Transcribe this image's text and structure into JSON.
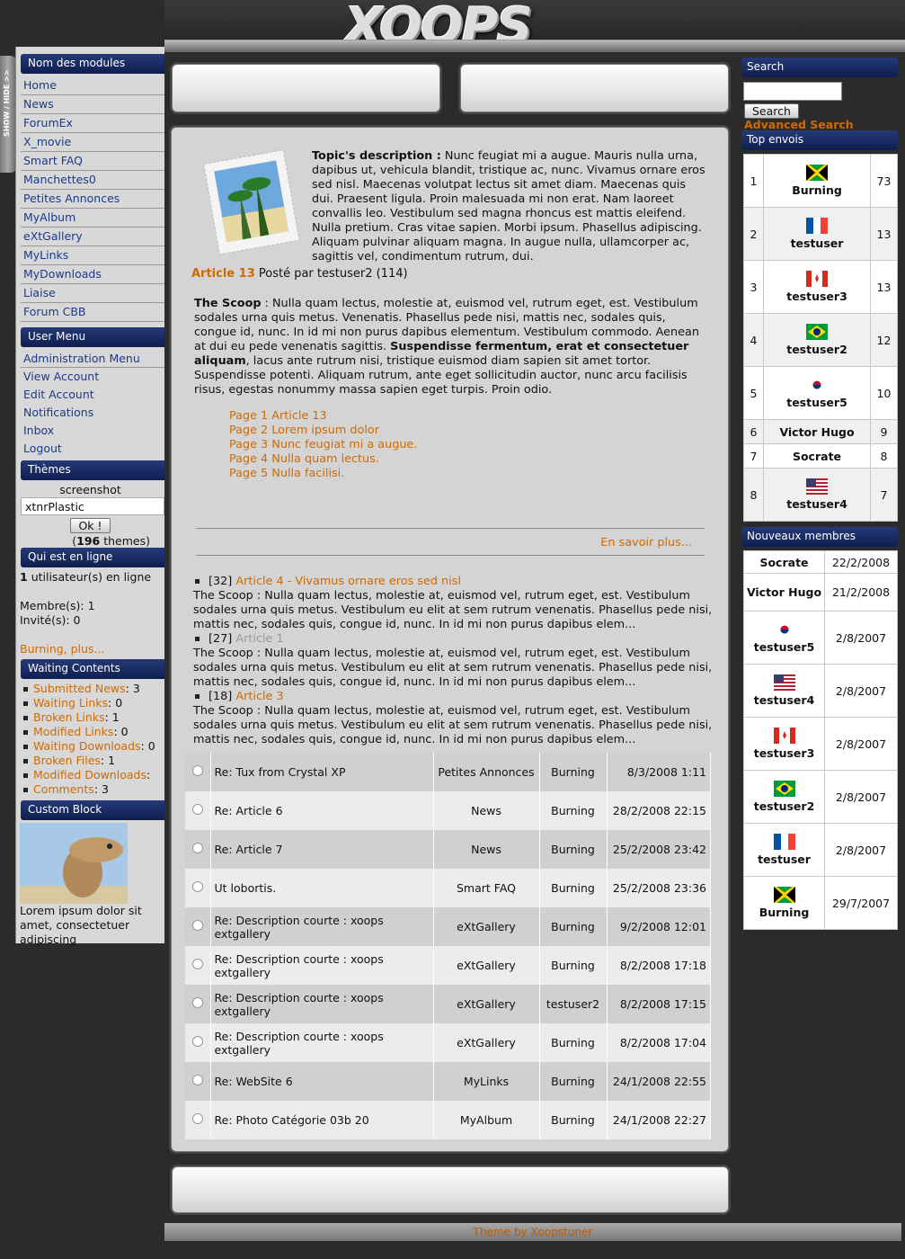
{
  "header": {
    "logo": "XOOPS"
  },
  "showhide": "SHOW / HIDE >>",
  "modules": {
    "title": "Nom des modules",
    "items": [
      "Home",
      "News",
      "ForumEx",
      "X_movie",
      "Smart FAQ",
      "Manchettes0",
      "Petites Annonces",
      "MyAlbum",
      "eXtGallery",
      "MyLinks",
      "MyDownloads",
      "Liaise",
      "Forum CBB"
    ]
  },
  "user_menu": {
    "title": "User Menu",
    "items": [
      "Administration Menu",
      "View Account",
      "Edit Account",
      "Notifications",
      "Inbox",
      "Logout"
    ]
  },
  "themes": {
    "title": "Thèmes",
    "screenshot": "screenshot",
    "selected": "xtnrPlastic",
    "ok": "Ok !",
    "count": "196",
    "count_suffix": "themes)",
    "count_prefix": "("
  },
  "online": {
    "title": "Qui est en ligne",
    "count": "1",
    "line1": "utilisateur(s) en ligne",
    "members": "Membre(s):  1",
    "guests": "Invité(s):  0",
    "user": "Burning",
    "more": "plus..."
  },
  "waiting": {
    "title": "Waiting Contents",
    "items": [
      {
        "label": "Submitted News",
        "count": "3"
      },
      {
        "label": "Waiting Links",
        "count": "0"
      },
      {
        "label": "Broken Links",
        "count": "1"
      },
      {
        "label": "Modified Links",
        "count": "0"
      },
      {
        "label": "Waiting Downloads",
        "count": "0"
      },
      {
        "label": "Broken Files",
        "count": "1"
      },
      {
        "label": "Modified Downloads",
        "count": ""
      },
      {
        "label": "Comments",
        "count": "3"
      }
    ]
  },
  "custom": {
    "title": "Custom Block",
    "text": "Lorem ipsum dolor sit amet, consectetuer adipiscing"
  },
  "article": {
    "topic_label": "Topic's description :",
    "topic_text": "Nunc feugiat mi a augue. Mauris nulla urna, dapibus ut, vehicula blandit, tristique ac, nunc. Vivamus ornare eros sed nisl. Maecenas volutpat lectus sit amet diam. Maecenas quis dui. Praesent ligula. Proin malesuada mi non erat. Nam laoreet convallis leo. Vestibulum sed magna rhoncus est mattis eleifend. Nulla pretium. Cras vitae sapien. Morbi ipsum. Phasellus adipiscing. Aliquam pulvinar aliquam magna. In augue nulla, ullamcorper ac, sagittis vel, condimentum rutrum, dui.",
    "link": "Article 13",
    "byline": " Posté par testuser2 (114)",
    "scoop_label": "The Scoop",
    "scoop_text1": " : Nulla quam lectus, molestie at, euismod vel, rutrum eget, est. Vestibulum sodales urna quis metus. Venenatis. Phasellus pede nisi, mattis nec, sodales quis, congue id, nunc. In id mi non purus dapibus elementum. Vestibulum commodo. Aenean at dui eu pede venenatis sagittis. ",
    "scoop_bold": "Suspendisse fermentum, erat et consectetuer aliquam",
    "scoop_text2": ", lacus ante rutrum nisi, tristique euismod diam sapien sit amet tortor. Suspendisse potenti. Aliquam rutrum, ante eget sollicitudin auctor, nunc arcu facilisis risus, egestas nonummy massa sapien eget turpis. Proin odio.",
    "pages": [
      "Page 1 Article 13",
      "Page 2 Lorem ipsum dolor",
      "Page 3 Nunc feugiat mi a augue.",
      "Page 4 Nulla quam lectus.",
      "Page 5 Nulla facilisi."
    ],
    "more": "En savoir plus..."
  },
  "news_list": [
    {
      "id": "[32]",
      "title": "Article 4 - Vivamus ornare eros sed nisl",
      "text": "The Scoop : Nulla quam lectus, molestie at, euismod vel, rutrum eget, est. Vestibulum sodales urna quis metus. Vestibulum eu elit at sem rutrum venenatis. Phasellus pede nisi, mattis nec, sodales quis, congue id, nunc. In id mi non purus dapibus elem..."
    },
    {
      "id": "[27]",
      "title": "Article 1",
      "text": "The Scoop : Nulla quam lectus, molestie at, euismod vel, rutrum eget, est. Vestibulum sodales urna quis metus. Vestibulum eu elit at sem rutrum venenatis. Phasellus pede nisi, mattis nec, sodales quis, congue id, nunc. In id mi non purus dapibus elem..."
    },
    {
      "id": "[18]",
      "title": "Article 3",
      "text": "The Scoop : Nulla quam lectus, molestie at, euismod vel, rutrum eget, est. Vestibulum sodales urna quis metus. Vestibulum eu elit at sem rutrum venenatis. Phasellus pede nisi, mattis nec, sodales quis, congue id, nunc. In id mi non purus dapibus elem..."
    }
  ],
  "recent": [
    {
      "title": "Re: Tux from Crystal XP",
      "module": "Petites Annonces",
      "user": "Burning",
      "date": "8/3/2008 1:11"
    },
    {
      "title": "Re: Article 6",
      "module": "News",
      "user": "Burning",
      "date": "28/2/2008 22:15"
    },
    {
      "title": "Re: Article 7",
      "module": "News",
      "user": "Burning",
      "date": "25/2/2008 23:42"
    },
    {
      "title": "Ut lobortis.",
      "module": "Smart FAQ",
      "user": "Burning",
      "date": "25/2/2008 23:36"
    },
    {
      "title": "Re: Description courte : xoops extgallery",
      "module": "eXtGallery",
      "user": "Burning",
      "date": "9/2/2008 12:01"
    },
    {
      "title": "Re: Description courte : xoops extgallery",
      "module": "eXtGallery",
      "user": "Burning",
      "date": "8/2/2008 17:18"
    },
    {
      "title": "Re: Description courte : xoops extgallery",
      "module": "eXtGallery",
      "user": "testuser2",
      "date": "8/2/2008 17:15"
    },
    {
      "title": "Re: Description courte : xoops extgallery",
      "module": "eXtGallery",
      "user": "Burning",
      "date": "8/2/2008 17:04"
    },
    {
      "title": "Re: WebSite 6",
      "module": "MyLinks",
      "user": "Burning",
      "date": "24/1/2008 22:55"
    },
    {
      "title": "Re: Photo Catégorie 03b 20",
      "module": "MyAlbum",
      "user": "Burning",
      "date": "24/1/2008 22:27"
    }
  ],
  "search": {
    "title": "Search",
    "button": "Search",
    "advanced": "Advanced Search"
  },
  "top": {
    "title": "Top envois",
    "rows": [
      {
        "rank": "1",
        "name": "Burning",
        "count": "73",
        "flag": "jamaica"
      },
      {
        "rank": "2",
        "name": "testuser",
        "count": "13",
        "flag": "france"
      },
      {
        "rank": "3",
        "name": "testuser3",
        "count": "13",
        "flag": "canada"
      },
      {
        "rank": "4",
        "name": "testuser2",
        "count": "12",
        "flag": "brazil"
      },
      {
        "rank": "5",
        "name": "testuser5",
        "count": "10",
        "flag": "korea"
      },
      {
        "rank": "6",
        "name": "Victor Hugo",
        "count": "9",
        "flag": ""
      },
      {
        "rank": "7",
        "name": "Socrate",
        "count": "8",
        "flag": ""
      },
      {
        "rank": "8",
        "name": "testuser4",
        "count": "7",
        "flag": "usa"
      }
    ]
  },
  "newmembers": {
    "title": "Nouveaux membres",
    "rows": [
      {
        "name": "Socrate",
        "date": "22/2/2008",
        "flag": ""
      },
      {
        "name": "Victor Hugo",
        "date": "21/2/2008",
        "flag": ""
      },
      {
        "name": "testuser5",
        "date": "2/8/2007",
        "flag": "korea"
      },
      {
        "name": "testuser4",
        "date": "2/8/2007",
        "flag": "usa"
      },
      {
        "name": "testuser3",
        "date": "2/8/2007",
        "flag": "canada"
      },
      {
        "name": "testuser2",
        "date": "2/8/2007",
        "flag": "brazil"
      },
      {
        "name": "testuser",
        "date": "2/8/2007",
        "flag": "france"
      },
      {
        "name": "Burning",
        "date": "29/7/2007",
        "flag": "jamaica"
      }
    ]
  },
  "footer": {
    "credit": "Theme by Xoopstuner"
  },
  "colors": {
    "link": "#1a3a8a",
    "accent": "#d06a00",
    "block_title": "#1a2d63"
  }
}
